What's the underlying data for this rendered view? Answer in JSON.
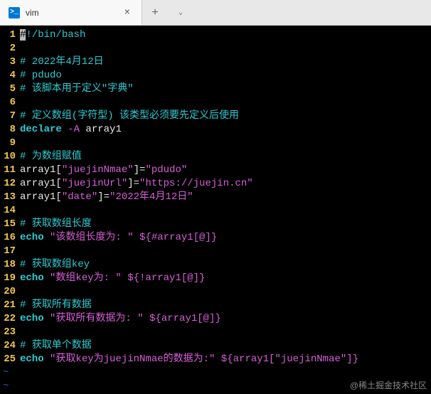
{
  "titlebar": {
    "tab_icon_glyph": ">_",
    "tab_title": "vim",
    "tab_close": "×",
    "new_tab": "+",
    "dropdown": "⌄"
  },
  "lines": [
    {
      "n": "1",
      "segs": [
        {
          "cls": "c-cursor",
          "t": "#"
        },
        {
          "cls": "c-comment",
          "t": "!/bin/bash"
        }
      ]
    },
    {
      "n": "2",
      "segs": []
    },
    {
      "n": "3",
      "segs": [
        {
          "cls": "c-comment",
          "t": "# 2022年4月12日"
        }
      ]
    },
    {
      "n": "4",
      "segs": [
        {
          "cls": "c-comment",
          "t": "# pdudo"
        }
      ]
    },
    {
      "n": "5",
      "segs": [
        {
          "cls": "c-comment",
          "t": "# 该脚本用于定义\"字典\""
        }
      ]
    },
    {
      "n": "6",
      "segs": []
    },
    {
      "n": "7",
      "segs": [
        {
          "cls": "c-comment",
          "t": "# 定义数组(字符型) 该类型必须要先定义后使用"
        }
      ]
    },
    {
      "n": "8",
      "segs": [
        {
          "cls": "c-fn",
          "t": "declare"
        },
        {
          "cls": "c-white",
          "t": " "
        },
        {
          "cls": "c-opt",
          "t": "-A"
        },
        {
          "cls": "c-white",
          "t": " array1"
        }
      ]
    },
    {
      "n": "9",
      "segs": []
    },
    {
      "n": "10",
      "segs": [
        {
          "cls": "c-comment",
          "t": "# 为数组赋值"
        }
      ]
    },
    {
      "n": "11",
      "segs": [
        {
          "cls": "c-white",
          "t": "array1["
        },
        {
          "cls": "c-str",
          "t": "\"juejinNmae\""
        },
        {
          "cls": "c-white",
          "t": "]="
        },
        {
          "cls": "c-str",
          "t": "\"pdudo\""
        }
      ]
    },
    {
      "n": "12",
      "segs": [
        {
          "cls": "c-white",
          "t": "array1["
        },
        {
          "cls": "c-str",
          "t": "\"juejinUrl\""
        },
        {
          "cls": "c-white",
          "t": "]="
        },
        {
          "cls": "c-str",
          "t": "\"https://juejin.cn\""
        }
      ]
    },
    {
      "n": "13",
      "segs": [
        {
          "cls": "c-white",
          "t": "array1["
        },
        {
          "cls": "c-str",
          "t": "\"date\""
        },
        {
          "cls": "c-white",
          "t": "]="
        },
        {
          "cls": "c-str",
          "t": "\"2022年4月12日\""
        }
      ]
    },
    {
      "n": "14",
      "segs": []
    },
    {
      "n": "15",
      "segs": [
        {
          "cls": "c-comment",
          "t": "# 获取数组长度"
        }
      ]
    },
    {
      "n": "16",
      "segs": [
        {
          "cls": "c-fn",
          "t": "echo"
        },
        {
          "cls": "c-white",
          "t": " "
        },
        {
          "cls": "c-str",
          "t": "\"该数组长度为: \""
        },
        {
          "cls": "c-white",
          "t": " "
        },
        {
          "cls": "c-var",
          "t": "${#array1[@]}"
        }
      ]
    },
    {
      "n": "17",
      "segs": []
    },
    {
      "n": "18",
      "segs": [
        {
          "cls": "c-comment",
          "t": "# 获取数组key"
        }
      ]
    },
    {
      "n": "19",
      "segs": [
        {
          "cls": "c-fn",
          "t": "echo"
        },
        {
          "cls": "c-white",
          "t": " "
        },
        {
          "cls": "c-str",
          "t": "\"数组key为: \""
        },
        {
          "cls": "c-white",
          "t": " "
        },
        {
          "cls": "c-var",
          "t": "${!array1[@]}"
        }
      ]
    },
    {
      "n": "20",
      "segs": []
    },
    {
      "n": "21",
      "segs": [
        {
          "cls": "c-comment",
          "t": "# 获取所有数据"
        }
      ]
    },
    {
      "n": "22",
      "segs": [
        {
          "cls": "c-fn",
          "t": "echo"
        },
        {
          "cls": "c-white",
          "t": " "
        },
        {
          "cls": "c-str",
          "t": "\"获取所有数据为: \""
        },
        {
          "cls": "c-white",
          "t": " "
        },
        {
          "cls": "c-var",
          "t": "${array1[@]}"
        }
      ]
    },
    {
      "n": "23",
      "segs": []
    },
    {
      "n": "24",
      "segs": [
        {
          "cls": "c-comment",
          "t": "# 获取单个数据"
        }
      ]
    },
    {
      "n": "25",
      "segs": [
        {
          "cls": "c-fn",
          "t": "echo"
        },
        {
          "cls": "c-white",
          "t": " "
        },
        {
          "cls": "c-str",
          "t": "\"获取key为juejinNmae的数据为:\""
        },
        {
          "cls": "c-white",
          "t": " "
        },
        {
          "cls": "c-var",
          "t": "${array1["
        },
        {
          "cls": "c-str",
          "t": "\"juejinNmae\""
        },
        {
          "cls": "c-var",
          "t": "]}"
        }
      ]
    }
  ],
  "tildes": [
    "~",
    "~"
  ],
  "watermark": "@稀土掘金技术社区"
}
